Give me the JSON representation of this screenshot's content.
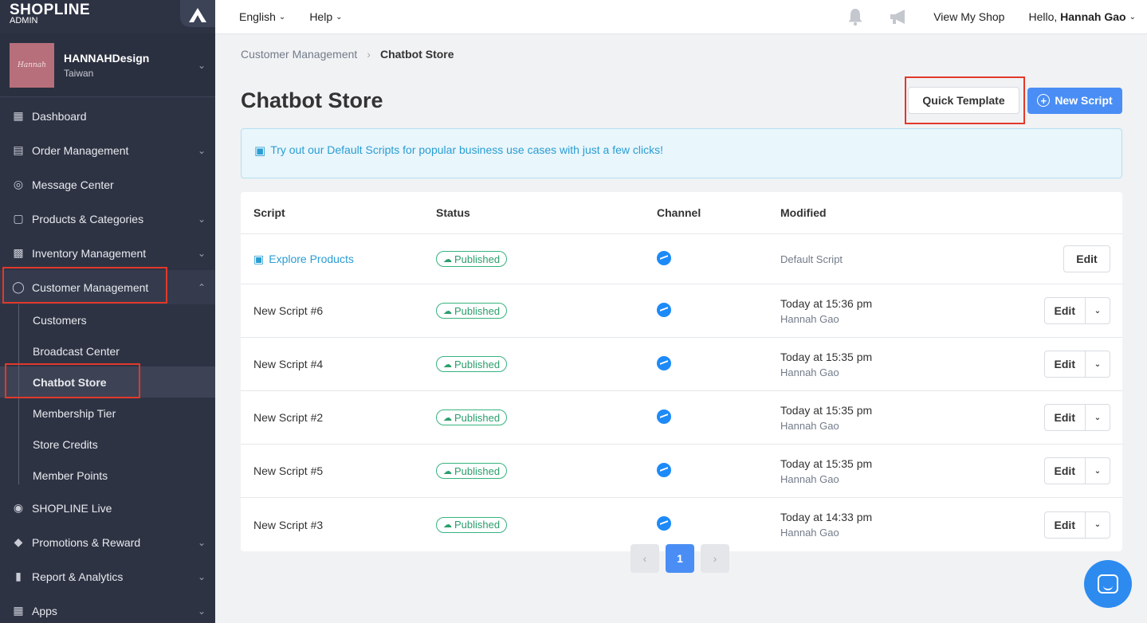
{
  "brand": {
    "name": "SHOPLINE",
    "sub": "ADMIN"
  },
  "shop": {
    "logo_text": "Hannah",
    "name": "HANNAHDesign",
    "region": "Taiwan"
  },
  "sidebar": {
    "items": [
      {
        "label": "Dashboard",
        "icon": "dashboard-icon"
      },
      {
        "label": "Order Management",
        "icon": "order-icon"
      },
      {
        "label": "Message Center",
        "icon": "message-icon"
      },
      {
        "label": "Products & Categories",
        "icon": "bag-icon"
      },
      {
        "label": "Inventory Management",
        "icon": "inventory-icon"
      },
      {
        "label": "Customer Management",
        "icon": "user-icon"
      }
    ],
    "sub_items": [
      {
        "label": "Customers"
      },
      {
        "label": "Broadcast Center"
      },
      {
        "label": "Chatbot Store"
      },
      {
        "label": "Membership Tier"
      },
      {
        "label": "Store Credits"
      },
      {
        "label": "Member Points"
      }
    ],
    "bottom_items": [
      {
        "label": "SHOPLINE Live",
        "icon": "broadcast-icon"
      },
      {
        "label": "Promotions & Reward",
        "icon": "tag-icon"
      },
      {
        "label": "Report & Analytics",
        "icon": "chart-icon"
      },
      {
        "label": "Apps",
        "icon": "apps-icon"
      }
    ]
  },
  "topbar": {
    "language": "English",
    "help": "Help",
    "view_shop": "View My Shop",
    "hello": "Hello,",
    "user": "Hannah Gao"
  },
  "breadcrumb": {
    "parent": "Customer Management",
    "current": "Chatbot Store"
  },
  "page": {
    "title": "Chatbot Store",
    "quick_template": "Quick Template",
    "new_script": "New Script",
    "banner": "Try out our Default Scripts for popular business use cases with just a few clicks!"
  },
  "table": {
    "headers": {
      "script": "Script",
      "status": "Status",
      "channel": "Channel",
      "modified": "Modified"
    },
    "rows": [
      {
        "script": "Explore Products",
        "status": "Published",
        "modified": "Default Script",
        "user": "",
        "edit": "Edit"
      },
      {
        "script": "New Script #6",
        "status": "Published",
        "modified": "Today at 15:36 pm",
        "user": "Hannah Gao",
        "edit": "Edit"
      },
      {
        "script": "New Script #4",
        "status": "Published",
        "modified": "Today at 15:35 pm",
        "user": "Hannah Gao",
        "edit": "Edit"
      },
      {
        "script": "New Script #2",
        "status": "Published",
        "modified": "Today at 15:35 pm",
        "user": "Hannah Gao",
        "edit": "Edit"
      },
      {
        "script": "New Script #5",
        "status": "Published",
        "modified": "Today at 15:35 pm",
        "user": "Hannah Gao",
        "edit": "Edit"
      },
      {
        "script": "New Script #3",
        "status": "Published",
        "modified": "Today at 14:33 pm",
        "user": "Hannah Gao",
        "edit": "Edit"
      }
    ]
  },
  "pagination": {
    "current": "1"
  },
  "colors": {
    "accent": "#4a8ef5",
    "sidebar": "#2e3344",
    "published": "#36b37e",
    "highlight": "#e2382a"
  }
}
